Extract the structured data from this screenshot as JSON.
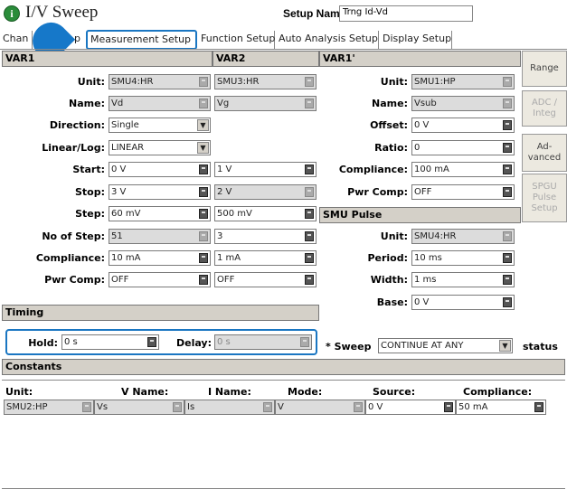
{
  "window": {
    "title": "I/V Sweep",
    "setup_name_label": "Setup Name:",
    "setup_name_value": "Trng Id-Vd"
  },
  "tabs": [
    "Chan",
    "Measurement Setup",
    "Function Setup",
    "Auto Analysis Setup",
    "Display Setup"
  ],
  "tabs_extra": "p",
  "var1": {
    "header": "VAR1",
    "unit": "SMU4:HR",
    "name": "Vd",
    "direction": "Single",
    "linear_log": "LINEAR",
    "start": "0 V",
    "stop": "3 V",
    "step": "60 mV",
    "no_of_step": "51",
    "compliance": "10 mA",
    "pwr_comp": "OFF"
  },
  "var2": {
    "header": "VAR2",
    "unit": "SMU3:HR",
    "name": "Vg",
    "start": "1 V",
    "stop": "2 V",
    "step": "500 mV",
    "no_of_step": "3",
    "compliance": "1 mA",
    "pwr_comp": "OFF"
  },
  "var1p": {
    "header": "VAR1'",
    "unit": "SMU1:HP",
    "name": "Vsub",
    "offset": "0 V",
    "ratio": "0",
    "compliance": "100 mA",
    "pwr_comp": "OFF"
  },
  "labels": {
    "unit": "Unit:",
    "name": "Name:",
    "direction": "Direction:",
    "linear_log": "Linear/Log:",
    "start": "Start:",
    "stop": "Stop:",
    "step": "Step:",
    "no_of_step": "No of Step:",
    "compliance": "Compliance:",
    "pwr_comp": "Pwr Comp:",
    "offset": "Offset:",
    "ratio": "Ratio:",
    "period": "Period:",
    "width": "Width:",
    "base": "Base:"
  },
  "smu_pulse": {
    "header": "SMU Pulse",
    "unit": "SMU4:HR",
    "period": "10 ms",
    "width": "1 ms",
    "base": "0 V"
  },
  "side_buttons": [
    "Range",
    "ADC / Integ",
    "Ad- vanced",
    "SPGU Pulse Setup"
  ],
  "timing": {
    "header": "Timing",
    "hold_label": "Hold:",
    "hold": "0 s",
    "delay_label": "Delay:",
    "delay": "0 s"
  },
  "sweep": {
    "label": "* Sweep",
    "value": "CONTINUE AT ANY",
    "status": "status"
  },
  "constants": {
    "header": "Constants",
    "columns": [
      "Unit:",
      "V Name:",
      "I Name:",
      "Mode:",
      "Source:",
      "Compliance:"
    ],
    "row": [
      "SMU2:HP",
      "Vs",
      "Is",
      "V",
      "0 V",
      "50 mA"
    ]
  }
}
